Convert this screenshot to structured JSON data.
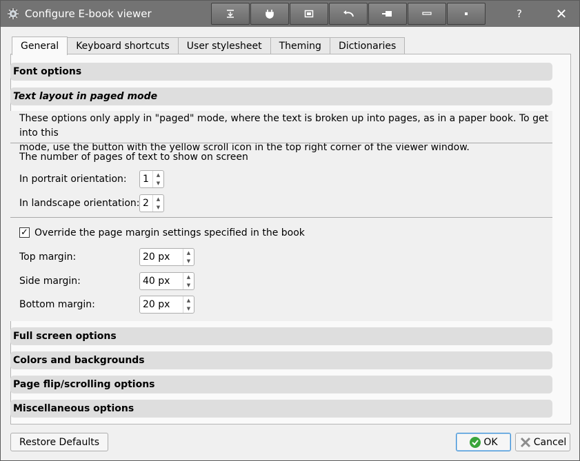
{
  "window": {
    "title": "Configure E-book viewer"
  },
  "titlebar": {
    "help": "?",
    "close": "✕",
    "toolbar_icons": [
      "fit-width-icon",
      "plug-icon",
      "fullscreen-icon",
      "undo-icon",
      "pin-icon",
      "minus-icon",
      "dot-icon"
    ]
  },
  "tabs": [
    {
      "label": "General",
      "active": true
    },
    {
      "label": "Keyboard shortcuts"
    },
    {
      "label": "User stylesheet"
    },
    {
      "label": "Theming"
    },
    {
      "label": "Dictionaries"
    }
  ],
  "sections": {
    "font_options": "Font options",
    "text_layout": "Text layout in paged mode",
    "full_screen": "Full screen options",
    "colors": "Colors and backgrounds",
    "page_flip": "Page flip/scrolling options",
    "misc": "Miscellaneous options"
  },
  "paged": {
    "description_1": "These options only apply in \"paged\" mode, where the text is broken up into pages, as in a paper book. To get into this",
    "description_2": "mode, use the button with the yellow scroll icon in the top right corner of the viewer window.",
    "pages_heading": "The number of pages of text to show on screen",
    "portrait_label": "In portrait orientation:",
    "portrait_value": "1",
    "landscape_label": "In landscape orientation:",
    "landscape_value": "2",
    "override_label": "Override the page margin settings specified in the book",
    "override_checked": "✓",
    "top_margin_label": "Top margin:",
    "top_margin_value": "20 px",
    "side_margin_label": "Side margin:",
    "side_margin_value": "40 px",
    "bottom_margin_label": "Bottom margin:",
    "bottom_margin_value": "20 px"
  },
  "buttons": {
    "restore": "Restore Defaults",
    "ok": "OK",
    "cancel": "Cancel"
  },
  "colors": {
    "titlebar": "#737373",
    "section_bar": "#dedede",
    "ok_border": "#3d8fd6",
    "ok_icon": "#3aa53a",
    "cancel_icon": "#8c8c8c"
  }
}
